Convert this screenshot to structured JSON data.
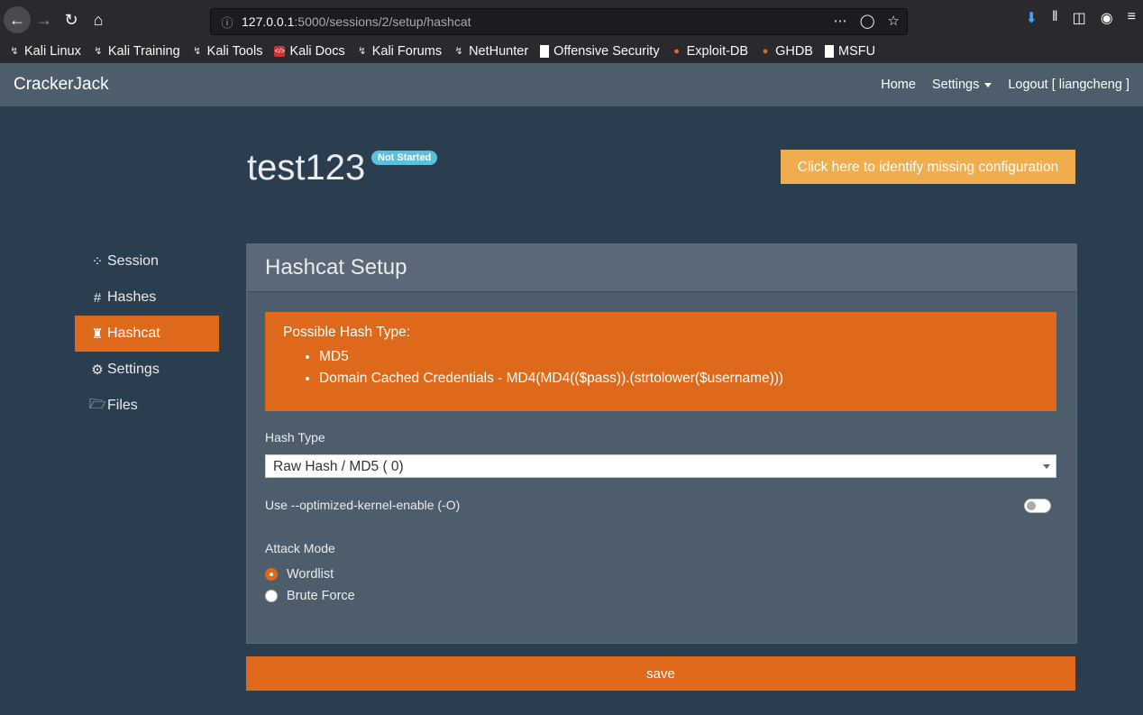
{
  "browser": {
    "url_host": "127.0.0.1",
    "url_path": ":5000/sessions/2/setup/hashcat",
    "bookmarks": [
      "Kali Linux",
      "Kali Training",
      "Kali Tools",
      "Kali Docs",
      "Kali Forums",
      "NetHunter",
      "Offensive Security",
      "Exploit-DB",
      "GHDB",
      "MSFU"
    ]
  },
  "navbar": {
    "brand": "CrackerJack",
    "home": "Home",
    "settings": "Settings",
    "logout": "Logout [ liangcheng ]"
  },
  "header": {
    "title": "test123",
    "status_badge": "Not Started",
    "identify_button": "Click here to identify missing configuration"
  },
  "sidebar": {
    "items": [
      {
        "label": "Session",
        "icon": "spinner-icon"
      },
      {
        "label": "Hashes",
        "icon": "hash-icon"
      },
      {
        "label": "Hashcat",
        "icon": "cat-icon",
        "active": true
      },
      {
        "label": "Settings",
        "icon": "gear-icon"
      },
      {
        "label": "Files",
        "icon": "folder-open-icon"
      }
    ]
  },
  "panel": {
    "title": "Hashcat Setup",
    "alert": {
      "title": "Possible Hash Type:",
      "items": [
        "MD5",
        "Domain Cached Credentials - MD4(MD4(($pass)).(strtolower($username)))"
      ]
    },
    "hash_type_label": "Hash Type",
    "hash_type_value": "Raw Hash / MD5 ( 0)",
    "optimized_label": "Use --optimized-kernel-enable (-O)",
    "optimized_enabled": false,
    "attack_mode_label": "Attack Mode",
    "attack_modes": [
      "Wordlist",
      "Brute Force"
    ],
    "attack_mode_selected": "Wordlist"
  },
  "save_button": "save",
  "colors": {
    "background": "#2b3e50",
    "accent": "#df691a",
    "warning": "#f0ad4e",
    "info": "#5bc0de",
    "panel": "#4e5d6c"
  }
}
